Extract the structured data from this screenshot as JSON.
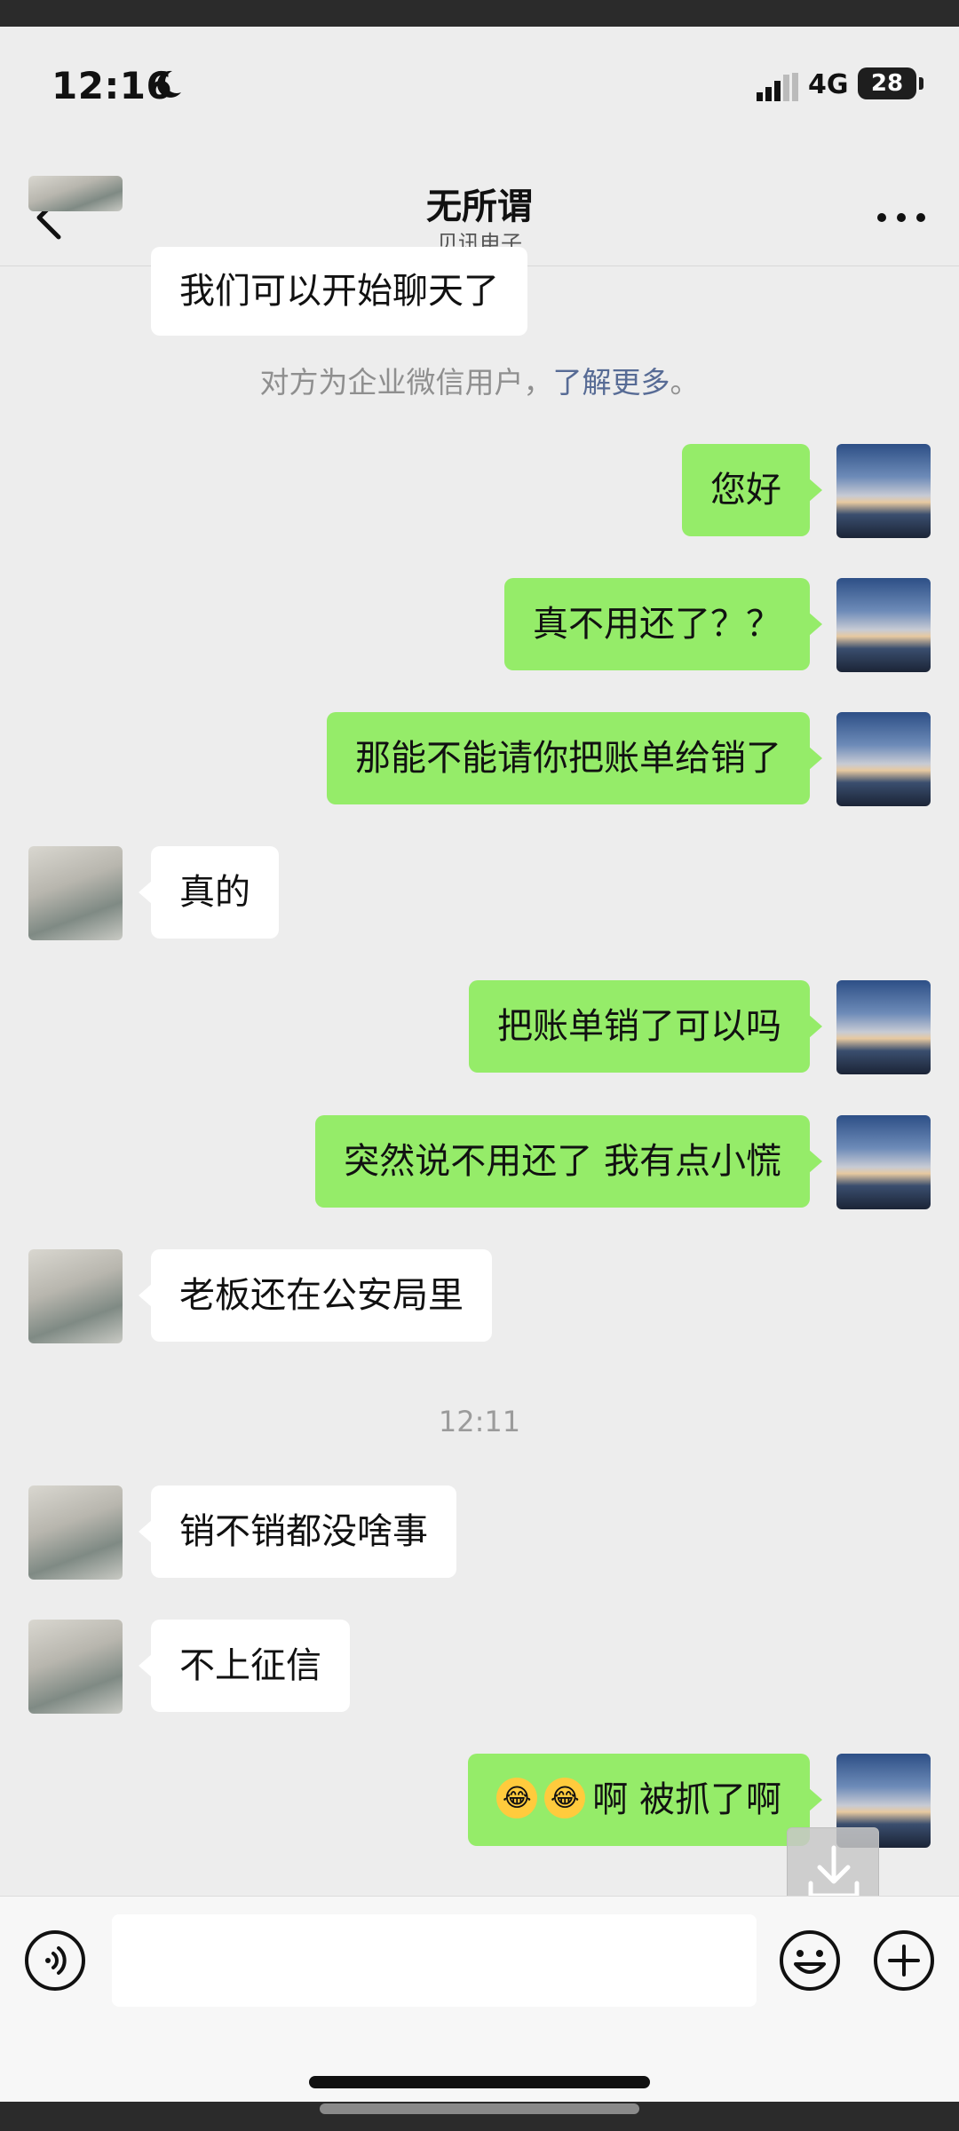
{
  "status_bar": {
    "time": "12:16",
    "network": "4G",
    "battery": "28"
  },
  "nav": {
    "title": "无所谓",
    "subtitle": "贝讯电子"
  },
  "messages": [
    {
      "text": "我们可以开始聊天了"
    },
    {
      "system_text": "对方为企业微信用户，",
      "system_link": "了解更多",
      "system_end": "。"
    },
    {
      "text": "您好"
    },
    {
      "text": "真不用还了？？"
    },
    {
      "text": "那能不能请你把账单给销了"
    },
    {
      "text": "真的"
    },
    {
      "text": "把账单销了可以吗"
    },
    {
      "text": "突然说不用还了 我有点小慌"
    },
    {
      "text": "老板还在公安局里"
    },
    {
      "timestamp": "12:11"
    },
    {
      "text": "销不销都没啥事"
    },
    {
      "text": "不上征信"
    },
    {
      "text": "啊 被抓了啊"
    }
  ],
  "icons": {
    "back": "chevron-left-icon",
    "more": "more-dots-icon",
    "voice": "voice-icon",
    "emoji": "emoji-icon",
    "plus": "plus-icon",
    "download": "download-icon"
  },
  "colors": {
    "outgoing": "#95ec69",
    "incoming": "#ffffff",
    "link": "#576b95",
    "background": "#ededed"
  }
}
